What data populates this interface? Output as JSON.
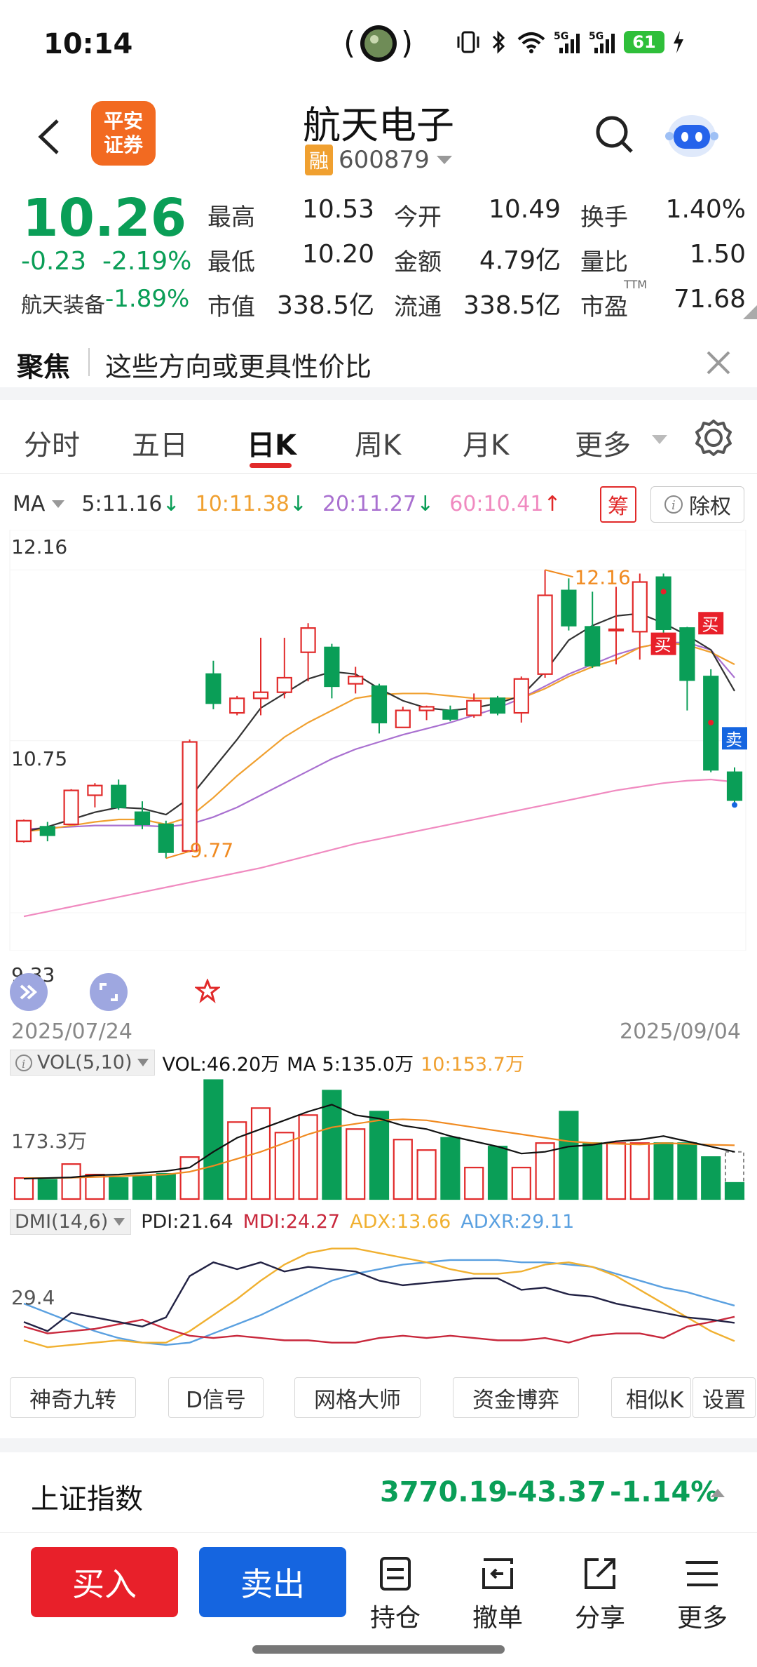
{
  "status_bar": {
    "time": "10:14",
    "battery": "61"
  },
  "header": {
    "title": "航天电子",
    "badge": "融",
    "code": "600879",
    "logo_line1": "平安",
    "logo_line2": "证券"
  },
  "quote": {
    "price": "10.26",
    "change": "-0.23",
    "change_pct": "-2.19%",
    "sector_name": "航天装备",
    "sector_pct": "-1.89%",
    "fields": [
      {
        "label": "最高",
        "value": "10.53",
        "color": "red"
      },
      {
        "label": "今开",
        "value": "10.49",
        "color": "default"
      },
      {
        "label": "换手",
        "value": "1.40%",
        "color": "default"
      },
      {
        "label": "最低",
        "value": "10.20",
        "color": "green"
      },
      {
        "label": "金额",
        "value": "4.79亿",
        "color": "default"
      },
      {
        "label": "量比",
        "value": "1.50",
        "color": "default"
      },
      {
        "label": "市值",
        "value": "338.5亿",
        "color": "default"
      },
      {
        "label": "流通",
        "value": "338.5亿",
        "color": "default"
      },
      {
        "label": "市盈",
        "value": "71.68",
        "color": "default"
      }
    ],
    "pe_sup": "TTM"
  },
  "focus": {
    "label": "聚焦",
    "text": "这些方向或更具性价比"
  },
  "tabs": [
    "分时",
    "五日",
    "日K",
    "周K",
    "月K",
    "更多"
  ],
  "active_tab": "日K",
  "ma_legend": {
    "label": "MA",
    "ma5": "5:11.16",
    "ma10": "10:11.38",
    "ma20": "20:11.27",
    "ma60": "60:10.41",
    "chip_btn": "筹",
    "ex_rights": "除权"
  },
  "colors": {
    "up": "#e12a2a",
    "down": "#0a9e57",
    "ma5": "#333333",
    "ma10": "#f0a030",
    "ma20": "#a970d0",
    "ma60": "#f08ac0",
    "buy": "#e8202a",
    "sell": "#1565e0"
  },
  "kline": {
    "y_labels": [
      "12.16",
      "10.75",
      "9.33"
    ],
    "date_start": "2025/07/24",
    "date_end": "2025/09/04",
    "high_mark": "12.16",
    "low_mark": "9.77",
    "signal_buy": "买",
    "signal_sell": "卖",
    "candles": [
      {
        "o": 9.92,
        "h": 10.1,
        "l": 9.91,
        "c": 10.09
      },
      {
        "o": 10.04,
        "h": 10.08,
        "l": 9.92,
        "c": 9.97
      },
      {
        "o": 10.06,
        "h": 10.35,
        "l": 10.06,
        "c": 10.34
      },
      {
        "o": 10.3,
        "h": 10.4,
        "l": 10.2,
        "c": 10.38
      },
      {
        "o": 10.38,
        "h": 10.43,
        "l": 10.18,
        "c": 10.2
      },
      {
        "o": 10.16,
        "h": 10.25,
        "l": 10.02,
        "c": 10.06
      },
      {
        "o": 10.06,
        "h": 10.09,
        "l": 9.78,
        "c": 9.83
      },
      {
        "o": 9.84,
        "h": 10.76,
        "l": 9.83,
        "c": 10.74
      },
      {
        "o": 11.3,
        "h": 11.41,
        "l": 11.01,
        "c": 11.06
      },
      {
        "o": 10.98,
        "h": 11.12,
        "l": 10.96,
        "c": 11.1
      },
      {
        "o": 11.1,
        "h": 11.6,
        "l": 10.96,
        "c": 11.15
      },
      {
        "o": 11.15,
        "h": 11.6,
        "l": 11.1,
        "c": 11.27
      },
      {
        "o": 11.48,
        "h": 11.72,
        "l": 11.24,
        "c": 11.68
      },
      {
        "o": 11.52,
        "h": 11.55,
        "l": 11.1,
        "c": 11.2
      },
      {
        "o": 11.22,
        "h": 11.36,
        "l": 11.14,
        "c": 11.28
      },
      {
        "o": 11.2,
        "h": 11.22,
        "l": 10.81,
        "c": 10.9
      },
      {
        "o": 10.86,
        "h": 11.03,
        "l": 10.86,
        "c": 11.0
      },
      {
        "o": 11.0,
        "h": 11.04,
        "l": 10.92,
        "c": 11.03
      },
      {
        "o": 11.0,
        "h": 11.04,
        "l": 10.91,
        "c": 10.93
      },
      {
        "o": 10.96,
        "h": 11.14,
        "l": 10.94,
        "c": 11.08
      },
      {
        "o": 11.1,
        "h": 11.12,
        "l": 10.96,
        "c": 10.98
      },
      {
        "o": 10.98,
        "h": 11.28,
        "l": 10.9,
        "c": 11.26
      },
      {
        "o": 11.3,
        "h": 12.16,
        "l": 11.27,
        "c": 11.95
      },
      {
        "o": 11.99,
        "h": 12.09,
        "l": 11.66,
        "c": 11.7
      },
      {
        "o": 11.69,
        "h": 11.98,
        "l": 11.35,
        "c": 11.37
      },
      {
        "o": 11.66,
        "h": 12.02,
        "l": 11.38,
        "c": 11.67
      },
      {
        "o": 11.65,
        "h": 12.13,
        "l": 11.42,
        "c": 12.06
      },
      {
        "o": 12.1,
        "h": 12.13,
        "l": 11.62,
        "c": 11.67
      },
      {
        "o": 11.68,
        "h": 11.69,
        "l": 11.0,
        "c": 11.25
      },
      {
        "o": 11.28,
        "h": 11.34,
        "l": 10.49,
        "c": 10.51
      },
      {
        "o": 10.49,
        "h": 10.53,
        "l": 10.2,
        "c": 10.26
      }
    ],
    "ma5": [
      10.0,
      10.04,
      10.1,
      10.16,
      10.2,
      10.19,
      10.14,
      10.28,
      10.52,
      10.76,
      11.02,
      11.14,
      11.26,
      11.32,
      11.3,
      11.18,
      11.08,
      11.02,
      11.0,
      11.02,
      11.06,
      11.12,
      11.32,
      11.58,
      11.7,
      11.78,
      11.8,
      11.72,
      11.62,
      11.5,
      11.16
    ],
    "ma10": [
      10.0,
      10.02,
      10.05,
      10.08,
      10.1,
      10.1,
      10.06,
      10.12,
      10.28,
      10.46,
      10.62,
      10.78,
      10.9,
      11.0,
      11.1,
      11.13,
      11.14,
      11.14,
      11.12,
      11.1,
      11.1,
      11.1,
      11.18,
      11.28,
      11.36,
      11.42,
      11.52,
      11.56,
      11.54,
      11.48,
      11.38
    ],
    "ma20": [
      10.02,
      10.03,
      10.04,
      10.05,
      10.05,
      10.05,
      10.04,
      10.06,
      10.12,
      10.2,
      10.3,
      10.4,
      10.5,
      10.6,
      10.68,
      10.74,
      10.8,
      10.85,
      10.9,
      10.96,
      11.02,
      11.1,
      11.2,
      11.3,
      11.38,
      11.46,
      11.52,
      11.56,
      11.56,
      11.5,
      11.27
    ],
    "ma60": [
      9.3,
      9.34,
      9.38,
      9.42,
      9.46,
      9.5,
      9.54,
      9.58,
      9.62,
      9.66,
      9.7,
      9.75,
      9.8,
      9.85,
      9.9,
      9.94,
      9.98,
      10.02,
      10.06,
      10.1,
      10.14,
      10.18,
      10.22,
      10.26,
      10.3,
      10.34,
      10.37,
      10.4,
      10.42,
      10.43,
      10.41
    ]
  },
  "volume": {
    "indicator": "VOL(5,10)",
    "vol": "VOL:46.20万",
    "ma5": "MA 5:135.0万",
    "ma10": "10:153.7万",
    "y_label": "173.3万",
    "values": [
      60,
      55,
      100,
      70,
      60,
      65,
      72,
      120,
      340,
      220,
      260,
      190,
      240,
      310,
      200,
      250,
      170,
      140,
      175,
      90,
      150,
      90,
      160,
      250,
      160,
      160,
      160,
      160,
      160,
      120,
      46.2
    ],
    "ma5_values": [
      58,
      60,
      62,
      68,
      70,
      75,
      80,
      90,
      135,
      175,
      200,
      225,
      250,
      270,
      240,
      230,
      210,
      200,
      180,
      165,
      150,
      130,
      135,
      150,
      155,
      165,
      170,
      180,
      165,
      150,
      135
    ],
    "ma10_values": [
      60,
      60,
      61,
      63,
      65,
      68,
      70,
      78,
      95,
      115,
      135,
      160,
      185,
      205,
      215,
      225,
      228,
      225,
      215,
      205,
      195,
      185,
      175,
      165,
      160,
      158,
      156,
      160,
      158,
      155,
      153.7
    ]
  },
  "dmi": {
    "indicator": "DMI(14,6)",
    "pdi": "PDI:21.64",
    "mdi": "MDI:24.27",
    "adx": "ADX:13.66",
    "adxr": "ADXR:29.11",
    "y_label": "29.4",
    "pdi_values": [
      22,
      18,
      26,
      24,
      22,
      20,
      24,
      42,
      48,
      45,
      48,
      44,
      46,
      45,
      44,
      40,
      38,
      39,
      40,
      41,
      41,
      36,
      37,
      34,
      33,
      30,
      28,
      26,
      24,
      23,
      21.64
    ],
    "mdi_values": [
      20,
      17,
      18,
      19,
      21,
      23,
      19,
      16,
      15,
      16,
      15,
      14,
      14,
      13,
      13,
      15,
      16,
      15,
      16,
      15,
      14,
      14,
      15,
      13,
      16,
      17,
      17,
      15,
      20,
      22,
      24.27
    ],
    "adx_values": [
      14,
      11,
      12,
      13,
      14,
      13,
      13,
      18,
      25,
      32,
      40,
      47,
      52,
      54,
      54,
      52,
      50,
      48,
      45,
      43,
      43,
      44,
      47,
      48,
      46,
      42,
      36,
      30,
      24,
      18,
      13.66
    ],
    "adxr_values": [
      30,
      26,
      22,
      18,
      15,
      13,
      12,
      13,
      17,
      21,
      25,
      30,
      35,
      40,
      43,
      45,
      47,
      48,
      49,
      49,
      49,
      48,
      48,
      47,
      46,
      43,
      40,
      37,
      35,
      32,
      29.11
    ]
  },
  "tools": [
    "神奇九转",
    "D信号",
    "网格大师",
    "资金博弈",
    "相似K",
    "设置"
  ],
  "index_bar": {
    "name": "上证指数",
    "value": "3770.19",
    "change": "-43.37",
    "pct": "-1.14%"
  },
  "bottom_bar": {
    "buy": "买入",
    "sell": "卖出",
    "position": "持仓",
    "cancel": "撤单",
    "share": "分享",
    "more": "更多"
  }
}
